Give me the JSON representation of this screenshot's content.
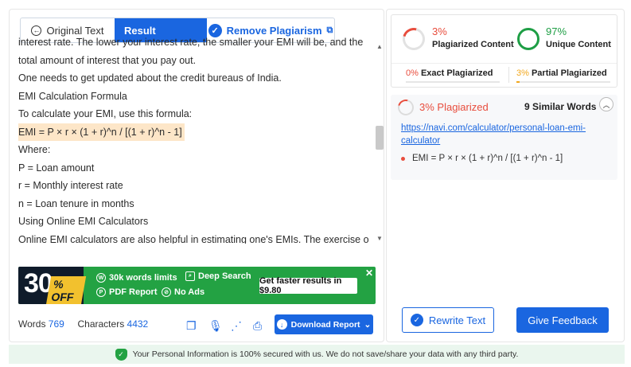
{
  "tabs": {
    "original": "Original Text",
    "result": "Result",
    "remove": "Remove Plagiarism"
  },
  "content": {
    "lines": [
      "interest rate. The lower your interest rate, the smaller your EMI will be, and the",
      "total amount of interest that you pay out.",
      "One needs to get updated about the credit bureaus of India.",
      "EMI Calculation Formula",
      "To calculate your EMI, use this formula:",
      "EMI = P × r × (1 + r)^n / [(1 + r)^n - 1]",
      "Where:",
      "P = Loan amount",
      "r = Monthly interest rate",
      "n = Loan tenure in months",
      "Using Online EMI Calculators",
      "Online EMI calculators are also helpful in estimating one's EMIs. The exercise of"
    ],
    "highlighted_line_index": 5
  },
  "promo": {
    "discount": "30",
    "off": "% OFF",
    "feature1": "30k words limits",
    "feature2": "Deep Search",
    "feature3": "PDF Report",
    "feature4": "No Ads",
    "cta": "Get faster results in $9.80",
    "close": "✕"
  },
  "stats": {
    "words_label": "Words",
    "words_value": "769",
    "chars_label": "Characters",
    "chars_value": "4432"
  },
  "download_label": "Download Report",
  "summary": {
    "plag_pct": "3%",
    "plag_label": "Plagiarized Content",
    "unique_pct": "97%",
    "unique_label": "Unique Content",
    "exact_pct": "0%",
    "exact_label": "Exact Plagiarized",
    "partial_pct": "3%",
    "partial_label": "Partial Plagiarized"
  },
  "source": {
    "pct_label": "3% Plagiarized",
    "similar_label": "9 Similar Words",
    "link": "https://navi.com/calculator/personal-loan-emi-calculator",
    "match_text": "EMI = P × r × (1 + r)^n / [(1 + r)^n - 1]"
  },
  "actions": {
    "rewrite": "Rewrite Text",
    "feedback": "Give Feedback"
  },
  "footer": {
    "notice": "Your Personal Information is 100% secured with us. We do not save/share your data with any third party."
  },
  "colors": {
    "brand": "#1a66e0",
    "plagiarized": "#e84d3d",
    "unique": "#1e9e45",
    "partial": "#f2a81e",
    "promo_green": "#23a243",
    "highlight": "#fde6c8"
  }
}
